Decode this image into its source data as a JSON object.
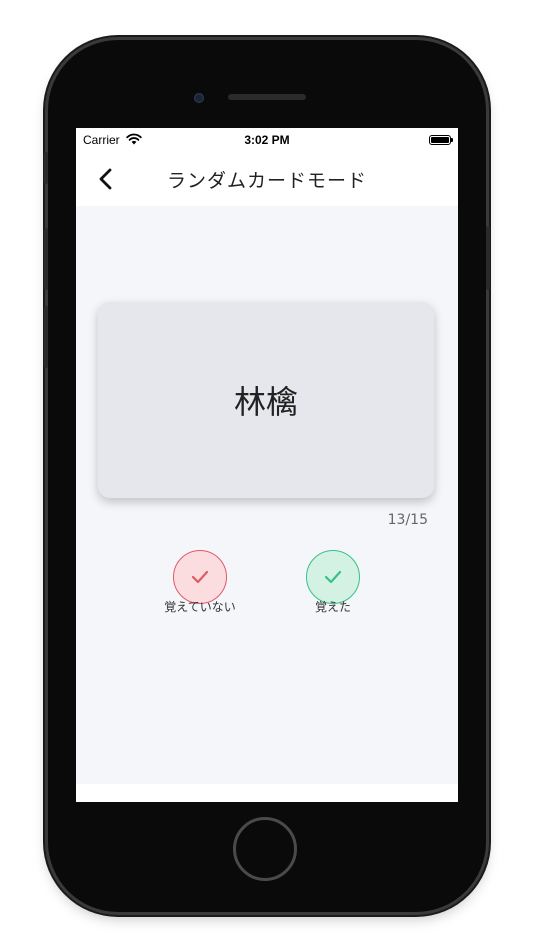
{
  "status_bar": {
    "carrier": "Carrier",
    "time": "3:02 PM",
    "wifi_icon": "wifi-icon",
    "battery_icon": "battery-icon",
    "battery_level": 1.0
  },
  "nav": {
    "back_icon": "chevron-left-icon",
    "title": "ランダムカードモード"
  },
  "card": {
    "word": "林檎"
  },
  "progress": {
    "text": "13/15"
  },
  "answers": {
    "not_remembered": {
      "label": "覚えていない",
      "icon": "check-icon",
      "color": "#e05a66",
      "bg": "#fbdde0"
    },
    "remembered": {
      "label": "覚えた",
      "icon": "check-icon",
      "color": "#3bbf8a",
      "bg": "#d3f2e4"
    }
  },
  "colors": {
    "screen_bg": "#f5f6fa",
    "card_bg": "#e6e7ec"
  }
}
